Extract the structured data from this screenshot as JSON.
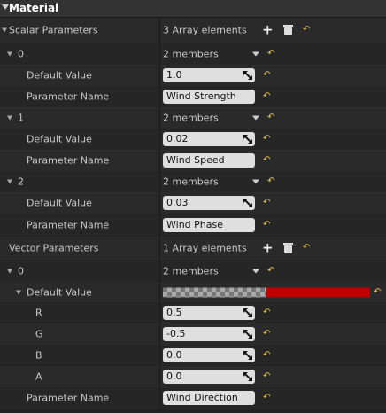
{
  "section": {
    "title": "Material"
  },
  "colors": {
    "reset_arrow": "#e8c94e",
    "color_swatch": "#c00000"
  },
  "scalar_parameters": {
    "label": "Scalar Parameters",
    "count": "3 Array elements",
    "add_icon": "plus-icon",
    "delete_icon": "trash-icon",
    "reset_icon": "reset-arrow-icon",
    "items": [
      {
        "index": "0",
        "members": "2 members",
        "default_value_label": "Default Value",
        "default_value": "1.0",
        "param_name_label": "Parameter Name",
        "param_name": "Wind Strength"
      },
      {
        "index": "1",
        "members": "2 members",
        "default_value_label": "Default Value",
        "default_value": "0.02",
        "param_name_label": "Parameter Name",
        "param_name": "Wind Speed"
      },
      {
        "index": "2",
        "members": "2 members",
        "default_value_label": "Default Value",
        "default_value": "0.03",
        "param_name_label": "Parameter Name",
        "param_name": "Wind Phase"
      }
    ]
  },
  "vector_parameters": {
    "label": "Vector Parameters",
    "count": "1 Array elements",
    "items": [
      {
        "index": "0",
        "members": "2 members",
        "default_value_label": "Default Value",
        "components": [
          {
            "label": "R",
            "value": "0.5"
          },
          {
            "label": "G",
            "value": "-0.5"
          },
          {
            "label": "B",
            "value": "0.0"
          },
          {
            "label": "A",
            "value": "0.0"
          }
        ],
        "param_name_label": "Parameter Name",
        "param_name": "Wind Direction"
      }
    ]
  }
}
